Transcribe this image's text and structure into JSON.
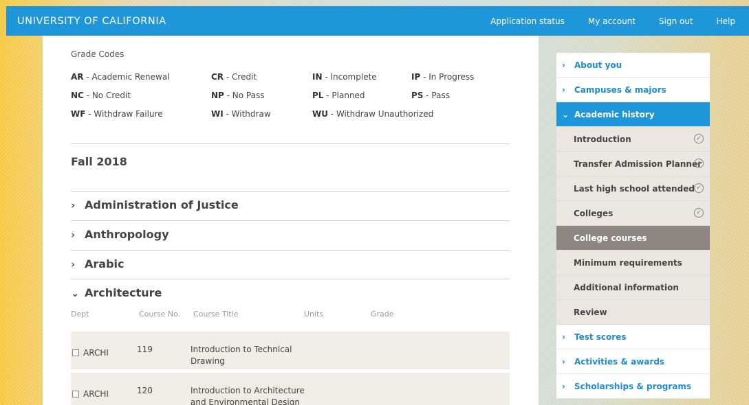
{
  "header": {
    "brand": "UNIVERSITY OF CALIFORNIA",
    "nav": [
      "Application status",
      "My account",
      "Sign out",
      "Help"
    ]
  },
  "grade_codes": {
    "title": "Grade Codes",
    "rows": [
      [
        {
          "code": "AR",
          "desc": " - Academic Renewal"
        },
        {
          "code": "CR",
          "desc": " - Credit"
        },
        {
          "code": "IN",
          "desc": " - Incomplete"
        },
        {
          "code": "IP",
          "desc": " - In Progress"
        }
      ],
      [
        {
          "code": "NC",
          "desc": " - No Credit"
        },
        {
          "code": "NP",
          "desc": " - No Pass"
        },
        {
          "code": "PL",
          "desc": " - Planned"
        },
        {
          "code": "PS",
          "desc": " - Pass"
        }
      ],
      [
        {
          "code": "WF",
          "desc": " - Withdraw Failure"
        },
        {
          "code": "WI",
          "desc": " - Withdraw"
        },
        {
          "code": "WU",
          "desc": " - Withdraw Unauthorized"
        }
      ]
    ]
  },
  "term": "Fall 2018",
  "subjects": [
    "Administration of Justice",
    "Anthropology",
    "Arabic",
    "Architecture"
  ],
  "course_table": {
    "headers": [
      "Dept",
      "Course No.",
      "Course Title",
      "Units",
      "Grade"
    ],
    "rows": [
      {
        "dept": "ARCHI",
        "num": "119",
        "title": "Introduction to Technical Drawing"
      },
      {
        "dept": "ARCHI",
        "num": "120",
        "title": "Introduction to Architecture and Environmental Design"
      }
    ]
  },
  "sidebar": {
    "top_items": [
      "About you",
      "Campuses & majors"
    ],
    "active": "Academic history",
    "sub_items": [
      {
        "label": "Introduction",
        "done": true
      },
      {
        "label": "Transfer Admission Planner",
        "done": true
      },
      {
        "label": "Last high school attended",
        "done": true
      },
      {
        "label": "Colleges",
        "done": true
      },
      {
        "label": "College courses",
        "current": true
      },
      {
        "label": "Minimum requirements"
      },
      {
        "label": "Additional information"
      },
      {
        "label": "Review"
      }
    ],
    "bottom_items": [
      "Test scores",
      "Activities & awards",
      "Scholarships & programs"
    ]
  },
  "icons": {
    "chevron_right": "›",
    "chevron_down": "⌄",
    "check": "✓"
  }
}
